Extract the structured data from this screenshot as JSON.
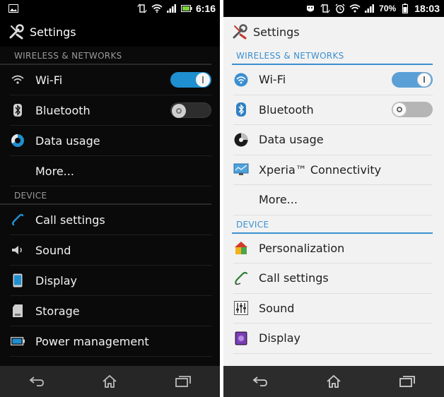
{
  "left": {
    "status": {
      "time": "6:16"
    },
    "title": "Settings",
    "sections": {
      "wireless": "WIRELESS & NETWORKS",
      "device": "DEVICE"
    },
    "wireless_items": {
      "wifi": "Wi-Fi",
      "bluetooth": "Bluetooth",
      "data_usage": "Data usage",
      "more": "More..."
    },
    "toggles": {
      "wifi": "on",
      "bluetooth": "off"
    },
    "device_items": {
      "call_settings": "Call settings",
      "sound": "Sound",
      "display": "Display",
      "storage": "Storage",
      "power_management": "Power management"
    }
  },
  "right": {
    "status": {
      "battery": "70%",
      "time": "18:03"
    },
    "title": "Settings",
    "sections": {
      "wireless": "WIRELESS & NETWORKS",
      "device": "DEVICE"
    },
    "wireless_items": {
      "wifi": "Wi-Fi",
      "bluetooth": "Bluetooth",
      "data_usage": "Data usage",
      "xperia": "Xperia™ Connectivity",
      "more": "More..."
    },
    "toggles": {
      "wifi": "on",
      "bluetooth": "off"
    },
    "device_items": {
      "personalization": "Personalization",
      "call_settings": "Call settings",
      "sound": "Sound",
      "display": "Display"
    }
  },
  "colors": {
    "accent_blue": "#1f8fd0",
    "holo_light_accent": "#3b8fd0"
  },
  "icons": [
    "wrench-icon",
    "wifi-icon",
    "bluetooth-icon",
    "data-usage-icon",
    "phone-icon",
    "speaker-icon",
    "display-icon",
    "storage-icon",
    "battery-icon",
    "back-icon",
    "home-icon",
    "recents-icon"
  ]
}
